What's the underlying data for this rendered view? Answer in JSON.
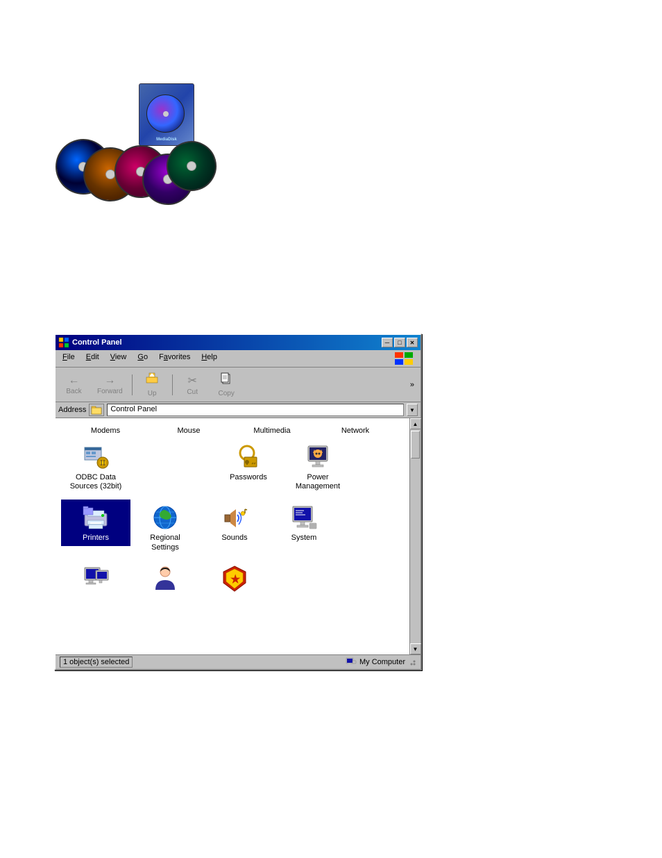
{
  "page": {
    "background": "#ffffff"
  },
  "cd_image": {
    "alt": "CD/DVD discs and software box"
  },
  "window": {
    "title": "Control Panel",
    "title_icon": "control-panel-icon",
    "min_btn": "─",
    "max_btn": "□",
    "close_btn": "✕",
    "menu": {
      "items": [
        {
          "label": "File",
          "underline_index": 0
        },
        {
          "label": "Edit",
          "underline_index": 0
        },
        {
          "label": "View",
          "underline_index": 0
        },
        {
          "label": "Go",
          "underline_index": 0
        },
        {
          "label": "Favorites",
          "underline_index": 0
        },
        {
          "label": "Help",
          "underline_index": 0
        }
      ]
    },
    "toolbar": {
      "buttons": [
        {
          "id": "back",
          "label": "Back",
          "icon": "←",
          "disabled": true
        },
        {
          "id": "forward",
          "label": "Forward",
          "icon": "→",
          "disabled": true
        },
        {
          "id": "up",
          "label": "Up",
          "icon": "↑",
          "disabled": false
        },
        {
          "id": "cut",
          "label": "Cut",
          "icon": "✂",
          "disabled": false
        },
        {
          "id": "copy",
          "label": "Copy",
          "icon": "📋",
          "disabled": false
        }
      ],
      "chevron": "»"
    },
    "address_bar": {
      "label": "Address",
      "value": "Control Panel"
    },
    "icon_rows": [
      {
        "type": "text-only",
        "items": [
          "Modems",
          "Mouse",
          "Multimedia",
          "Network"
        ]
      },
      {
        "type": "icon-row",
        "items": [
          {
            "id": "odbc",
            "label": "ODBC Data\nSources (32bit)",
            "icon": "odbc-icon"
          },
          {
            "id": "spacer",
            "label": "",
            "icon": ""
          },
          {
            "id": "passwords",
            "label": "Passwords",
            "icon": "passwords-icon"
          },
          {
            "id": "power",
            "label": "Power\nManagement",
            "icon": "power-icon"
          }
        ]
      },
      {
        "type": "icon-row",
        "items": [
          {
            "id": "printers",
            "label": "Printers",
            "icon": "printers-icon",
            "selected": true
          },
          {
            "id": "regional",
            "label": "Regional\nSettings",
            "icon": "regional-icon"
          },
          {
            "id": "sounds",
            "label": "Sounds",
            "icon": "sounds-icon"
          },
          {
            "id": "system",
            "label": "System",
            "icon": "system-icon"
          }
        ]
      },
      {
        "type": "icon-row-partial",
        "items": [
          {
            "id": "item1",
            "label": "...",
            "icon": "computer-icon"
          },
          {
            "id": "item2",
            "label": "...",
            "icon": "user-icon"
          },
          {
            "id": "item3",
            "label": "...",
            "icon": "shield-icon"
          }
        ]
      }
    ],
    "status_bar": {
      "left": "1 object(s) selected",
      "right": "My Computer",
      "right_icon": "my-computer-icon"
    }
  }
}
